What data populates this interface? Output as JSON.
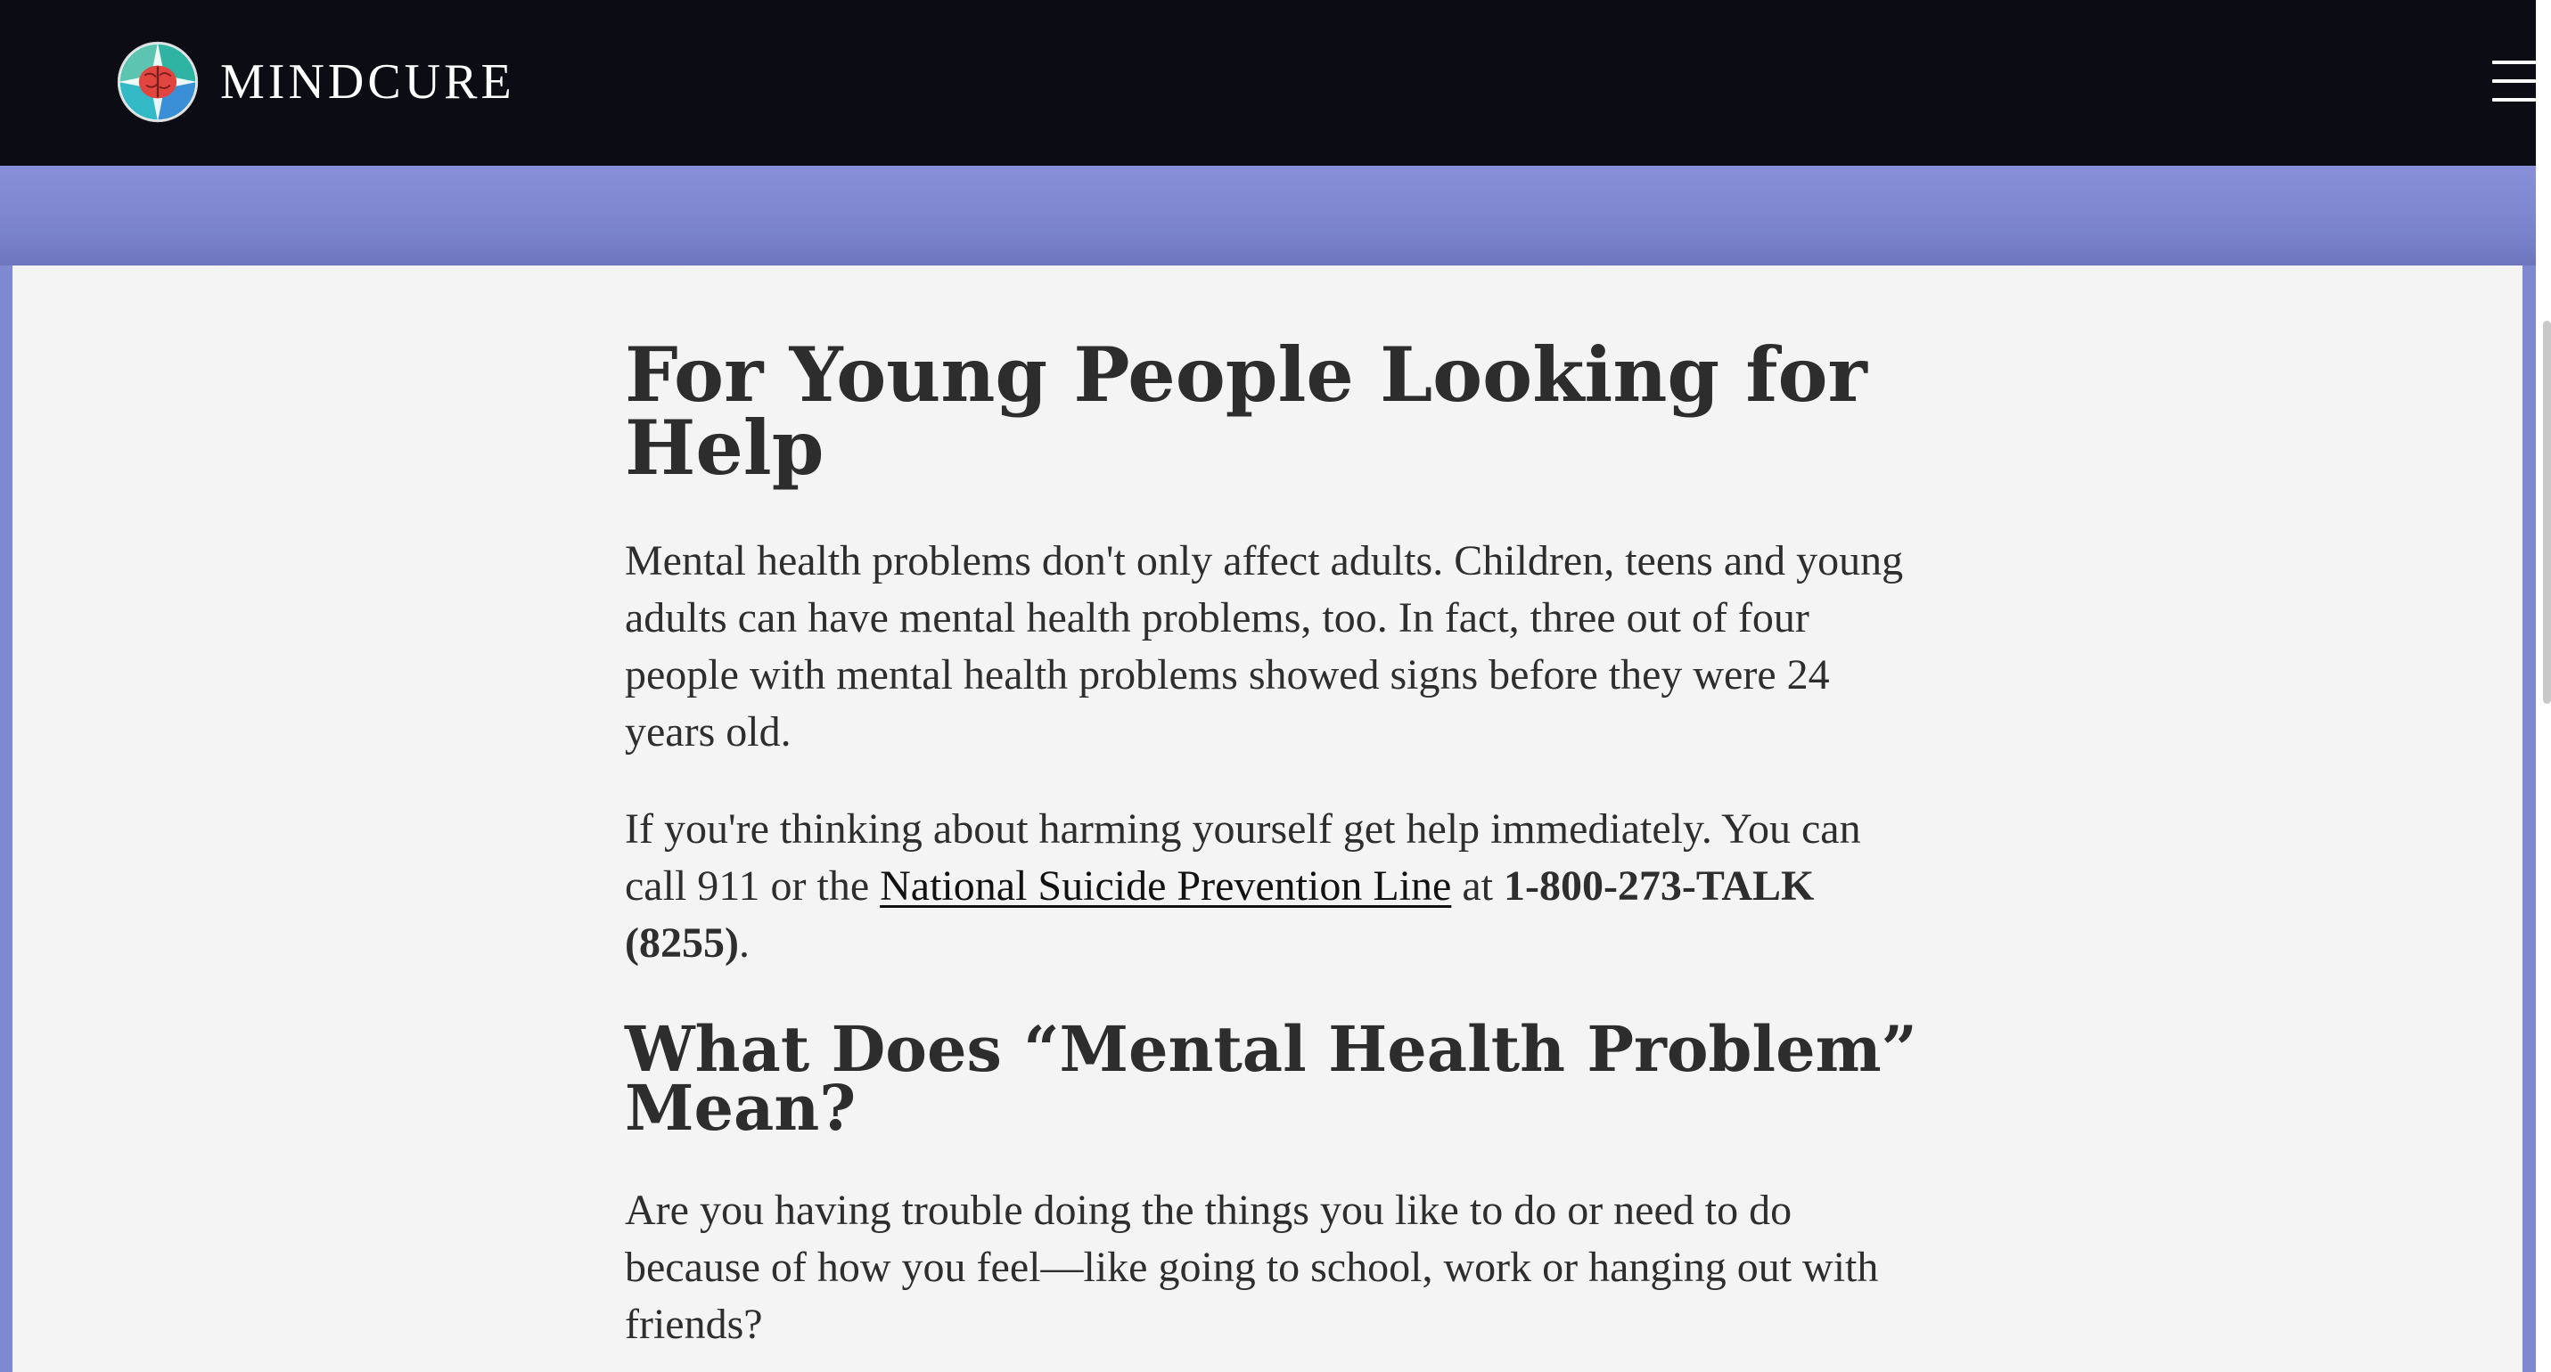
{
  "header": {
    "brand_name": "MINDCURE",
    "logo_icon": "brain-logo-icon",
    "menu_icon": "hamburger-menu-icon"
  },
  "colors": {
    "header_bg": "#0c0d14",
    "banner_bg": "#7e89d1",
    "content_bg": "#f4f4f4",
    "text": "#2e2e2e"
  },
  "article": {
    "title": "For Young People Looking for Help",
    "paragraph1": "Mental health problems don't only affect adults. Children, teens and young adults can have mental health problems, too. In fact, three out of four people with mental health problems showed signs before they were 24 years old.",
    "paragraph2": {
      "before_link": "If you're thinking about harming yourself get help immediately. You can call 911 or the ",
      "link_text": "National Suicide Prevention Line",
      "between": " at ",
      "phone": "1-800-273-TALK (8255)",
      "after": "."
    },
    "section_heading": "What Does “Mental Health Problem” Mean?",
    "paragraph3": "Are you having trouble doing the things you like to do or need to do because of how you feel—like going to school, work or hanging out with friends?"
  }
}
